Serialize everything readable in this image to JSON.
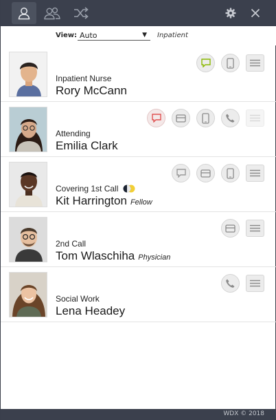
{
  "toolbar": {
    "tabs": [
      {
        "icon": "person-icon",
        "active": true
      },
      {
        "icon": "group-icon",
        "active": false
      },
      {
        "icon": "shuffle-icon",
        "active": false
      }
    ],
    "settings_icon": "gear-icon",
    "close_icon": "close-icon"
  },
  "view": {
    "label": "View:",
    "selected": "Auto",
    "context": "Inpatient"
  },
  "contacts": [
    {
      "role": "Inpatient Nurse",
      "name": "Rory McCann",
      "qualifier": "",
      "status": "",
      "actions": [
        "message",
        "mobile"
      ],
      "menu_enabled": true
    },
    {
      "role": "Attending",
      "name": "Emilia Clark",
      "qualifier": "",
      "status": "",
      "actions": [
        "message",
        "pager",
        "mobile",
        "phone"
      ],
      "menu_enabled": false
    },
    {
      "role": "Covering 1st Call",
      "name": "Kit Harrington",
      "qualifier": "Fellow",
      "status": "half-moon-icon",
      "actions": [
        "message",
        "pager",
        "mobile"
      ],
      "menu_enabled": true
    },
    {
      "role": "2nd Call",
      "name": "Tom Wlaschiha",
      "qualifier": "Physician",
      "status": "",
      "actions": [
        "pager"
      ],
      "menu_enabled": true
    },
    {
      "role": "Social Work",
      "name": "Lena Headey",
      "qualifier": "",
      "status": "",
      "actions": [
        "phone"
      ],
      "menu_enabled": true
    }
  ],
  "footer": {
    "text": "WDX © 2018"
  },
  "colors": {
    "toolbar": "#3b404d",
    "message_green": "#8ab800",
    "message_red": "#e05050"
  }
}
